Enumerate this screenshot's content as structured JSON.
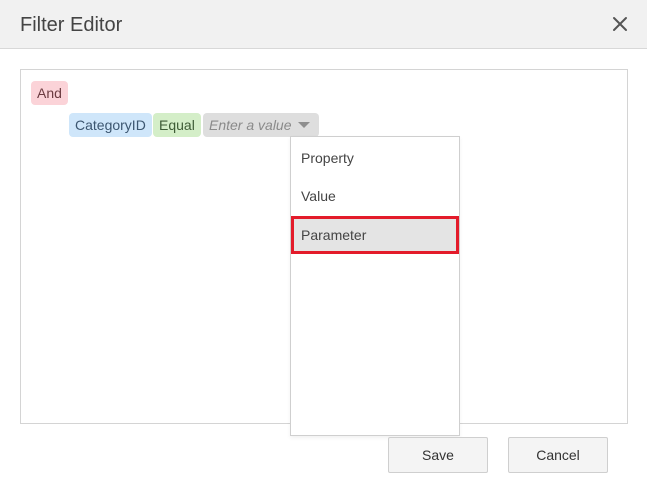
{
  "dialog": {
    "title": "Filter Editor",
    "close_icon": "close-icon"
  },
  "filter": {
    "group_operator": "And",
    "condition": {
      "property": "CategoryID",
      "operator": "Equal",
      "value_placeholder": "Enter a value",
      "value_dropdown_icon": "chevron-down-icon"
    }
  },
  "dropdown": {
    "items": [
      {
        "label": "Property"
      },
      {
        "label": "Value"
      },
      {
        "label": "Parameter",
        "highlighted": true
      }
    ]
  },
  "footer": {
    "save_label": "Save",
    "cancel_label": "Cancel"
  },
  "colors": {
    "group_chip": "#fbd3d8",
    "property_chip": "#cfe6fa",
    "operator_chip": "#d4eec8",
    "value_chip": "#dedede",
    "highlight_outline": "#e31b2a"
  }
}
